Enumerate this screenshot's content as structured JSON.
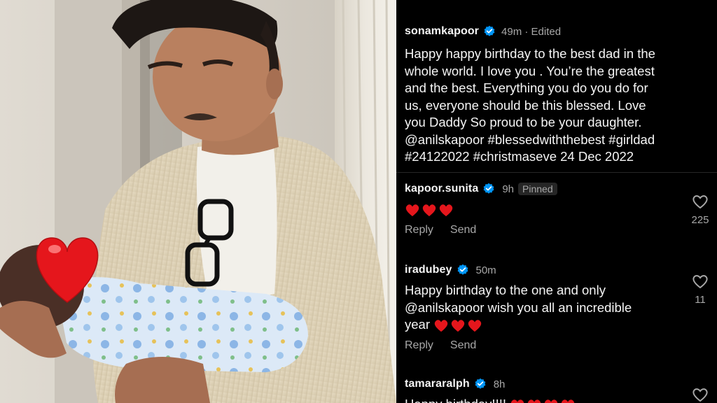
{
  "caption": {
    "username": "sonamkapoor",
    "meta": "49m · Edited",
    "text": "Happy happy birthday to the best dad in the\nwhole world. I love you . You’re the greatest\nand the best. Everything you do you do for\nus, everyone should be this blessed. Love\nyou Daddy So proud to be your daughter.\n@anilskapoor #blessedwiththebest #girldad\n#24122022 #christmaseve 24 Dec 2022"
  },
  "comments": [
    {
      "username": "kapoor.sunita",
      "time": "9h",
      "badge": "Pinned",
      "text": "",
      "hearts": 3,
      "likes": "225",
      "reply": "Reply",
      "send": "Send"
    },
    {
      "username": "iradubey",
      "time": "50m",
      "text_line1": "Happy birthday to the one and only",
      "text_line2": "@anilskapoor wish you all an incredible",
      "text_line3": "year",
      "hearts": 3,
      "likes": "11",
      "reply": "Reply",
      "send": "Send"
    },
    {
      "username": "tamararalph",
      "time": "8h",
      "text": "Happy birthday!!!! "
    }
  ],
  "colors": {
    "background": "#000000",
    "text": "#f5f5f5",
    "muted": "#a8a8a8",
    "verified": "#0095f6",
    "heart": "#e0245e"
  },
  "icons": [
    "verified-badge-icon",
    "like-heart-icon",
    "red-heart-emoji"
  ]
}
